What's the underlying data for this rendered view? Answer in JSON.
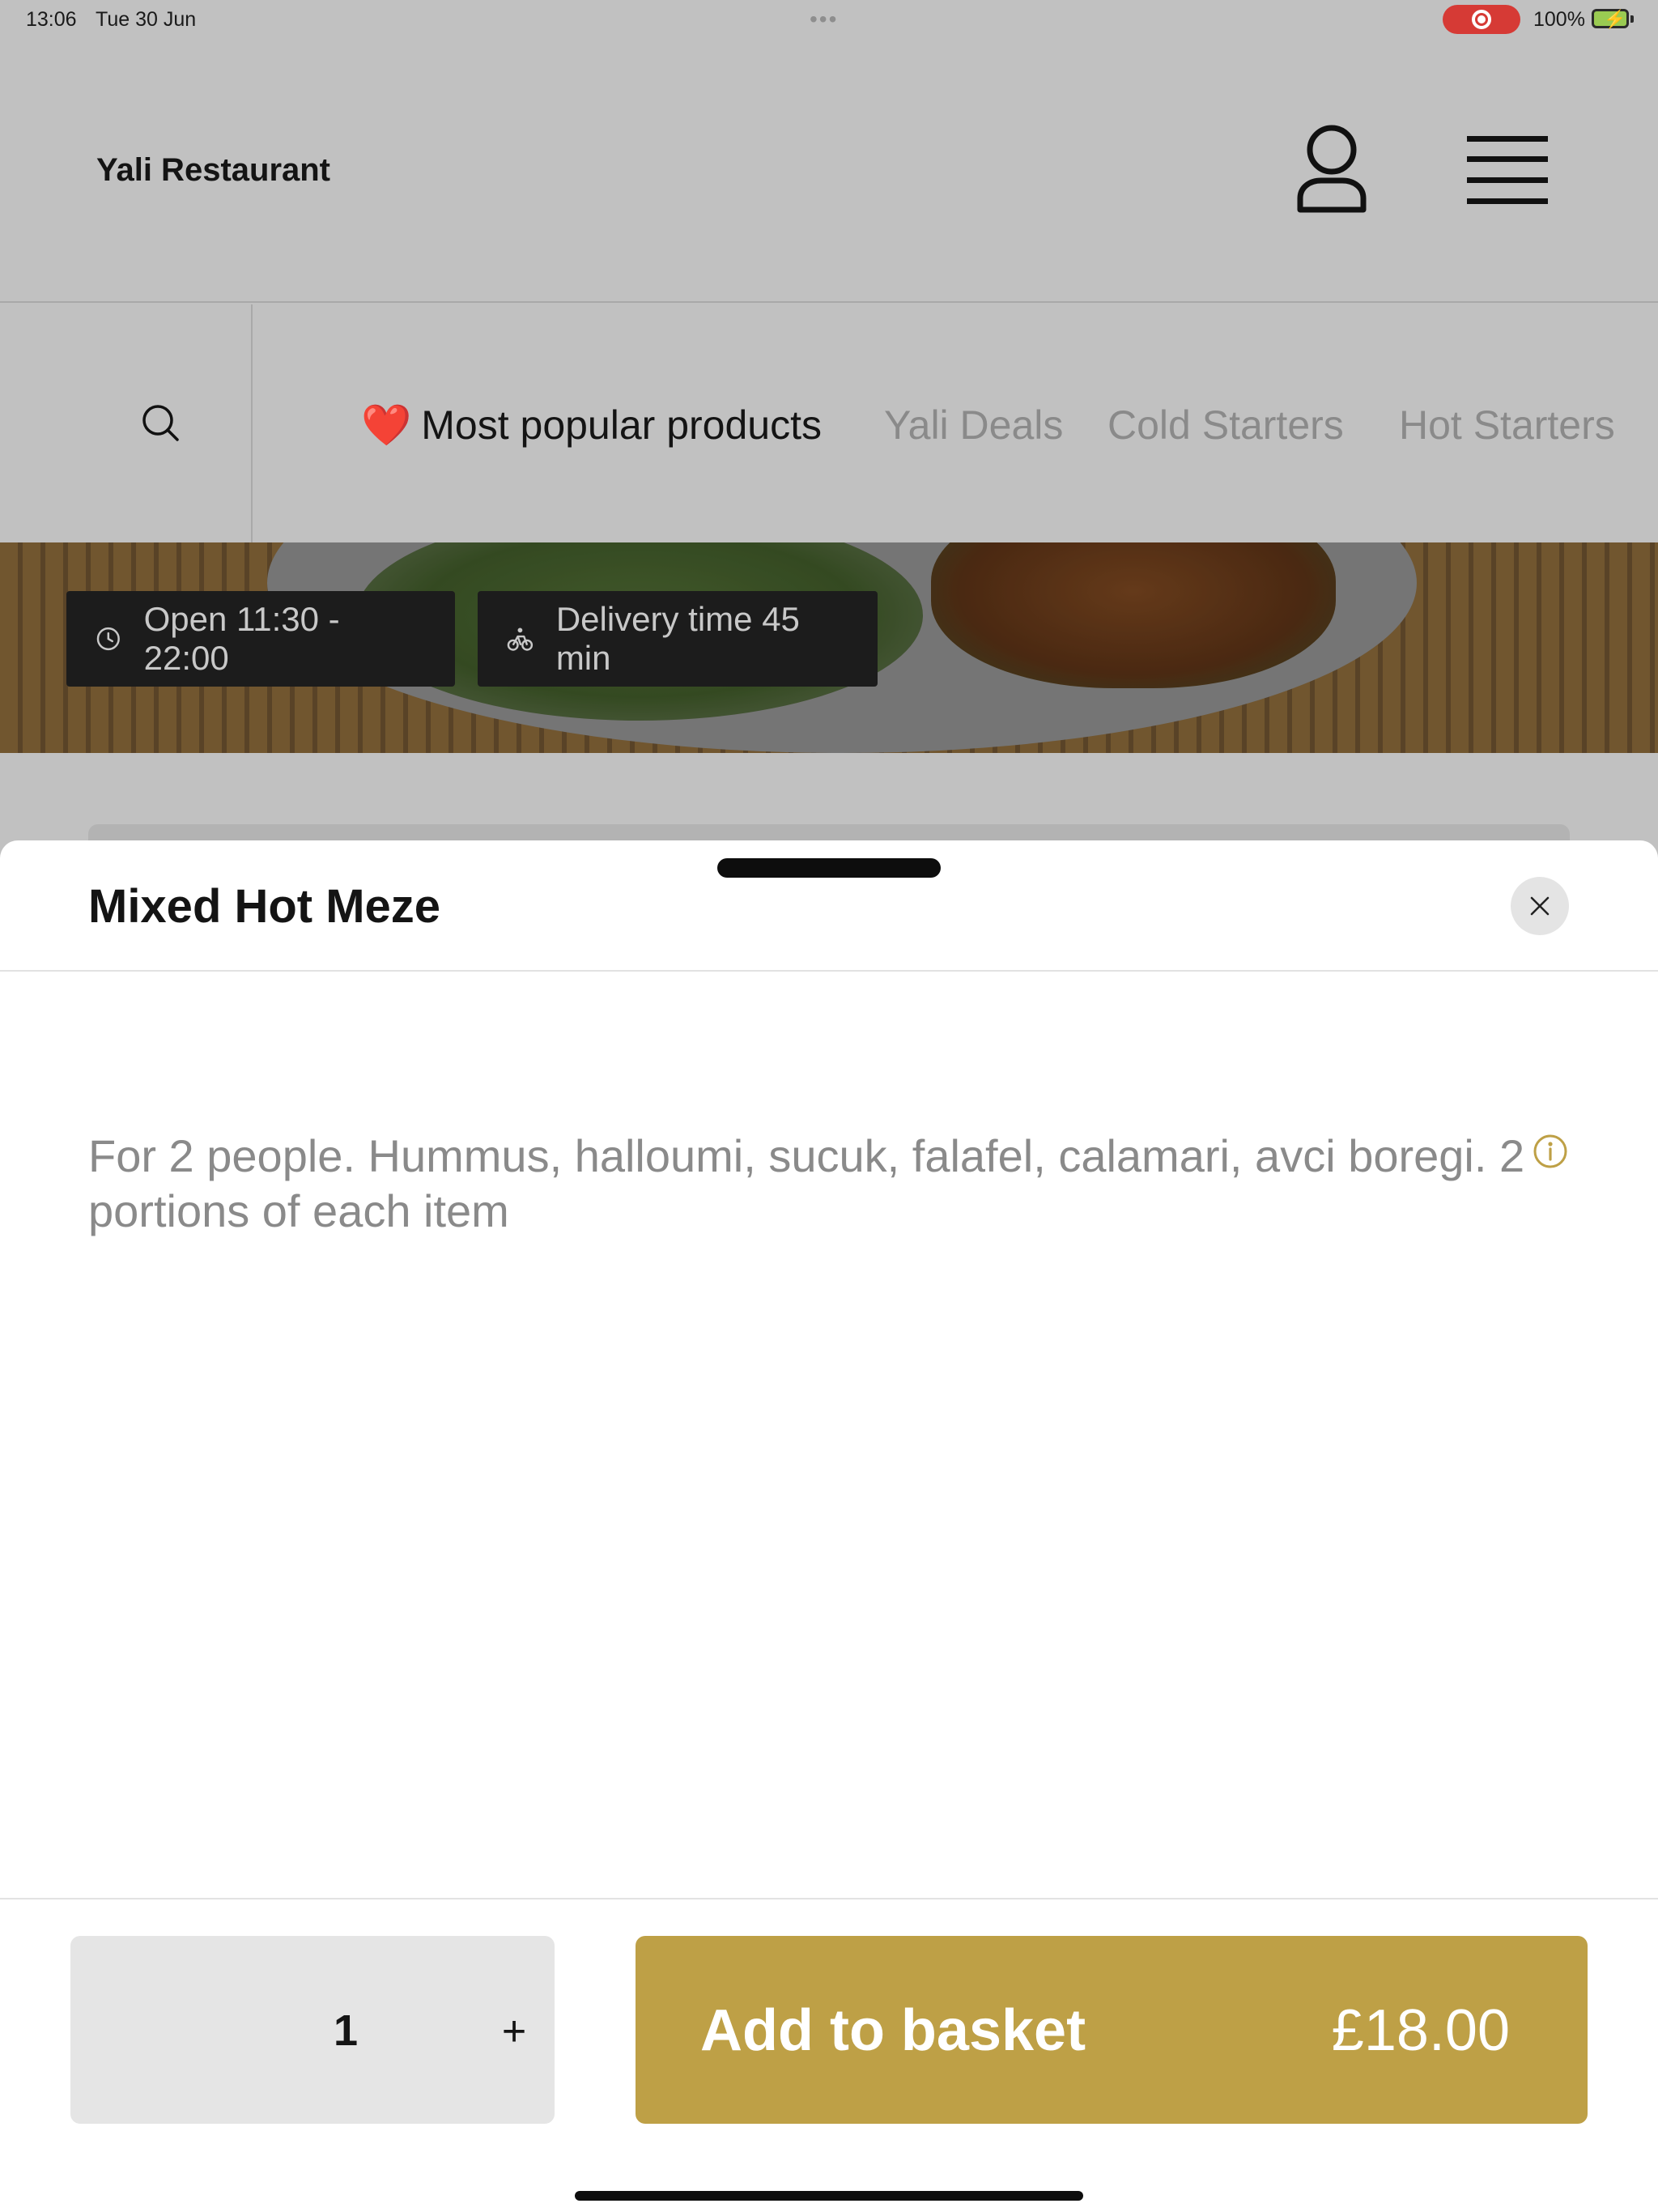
{
  "status_bar": {
    "time": "13:06",
    "date": "Tue 30 Jun",
    "battery": "100%"
  },
  "header": {
    "brand": "Yali Restaurant",
    "icons": [
      "person-icon",
      "hamburger-menu-icon"
    ]
  },
  "categories": {
    "search_icon": "search-icon",
    "active": {
      "emoji": "❤️",
      "label": "Most popular products"
    },
    "items": [
      "Yali Deals",
      "Cold Starters",
      "Hot Starters"
    ]
  },
  "info_pills": {
    "hours": "Open 11:30 - 22:00",
    "delivery": "Delivery time 45 min"
  },
  "product_sheet": {
    "title": "Mixed Hot Meze",
    "description": "For 2 people. Hummus, halloumi, sucuk, falafel, calamari, avci boregi. 2 portions of each item",
    "quantity": "1",
    "plus_label": "+",
    "add_label": "Add to basket",
    "price": "£18.00"
  },
  "colors": {
    "accent": "#bea046",
    "overlay_bg": "#c1c1c1",
    "heart": "#c0262d"
  }
}
